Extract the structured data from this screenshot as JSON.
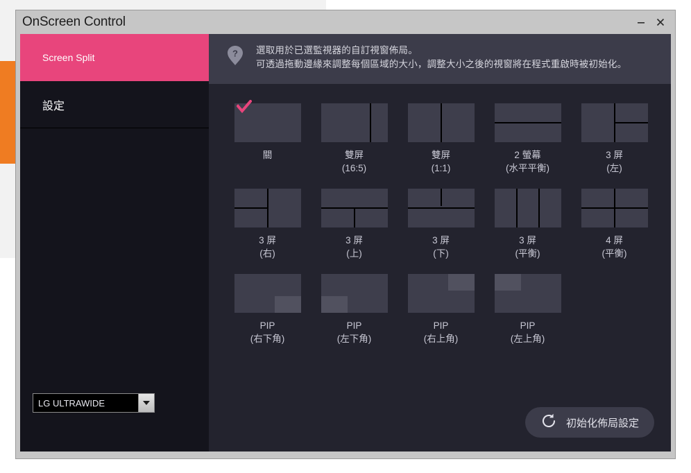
{
  "window": {
    "title": "OnScreen Control",
    "minimize_label": "–",
    "close_label": "×"
  },
  "sidebar": {
    "items": [
      {
        "label": "Screen Split",
        "active": true
      },
      {
        "label": "設定",
        "active": false
      }
    ],
    "monitor_select": {
      "value": "LG ULTRAWIDE"
    }
  },
  "info": {
    "text": "選取用於已選監視器的自訂視窗佈局。\n可透過拖動邊緣來調整每個區域的大小，調整大小之後的視窗將在程式重啟時被初始化。",
    "icon": "help-icon"
  },
  "layouts": [
    {
      "caption": "關",
      "selected": true
    },
    {
      "caption": "雙屏\n(16:5)",
      "selected": false
    },
    {
      "caption": "雙屏\n(1:1)",
      "selected": false
    },
    {
      "caption": "2 螢幕\n(水平平衡)",
      "selected": false
    },
    {
      "caption": "3 屏\n(左)",
      "selected": false
    },
    {
      "caption": "3 屏\n(右)",
      "selected": false
    },
    {
      "caption": "3 屏\n(上)",
      "selected": false
    },
    {
      "caption": "3 屏\n(下)",
      "selected": false
    },
    {
      "caption": "3 屏\n(平衡)",
      "selected": false
    },
    {
      "caption": "4 屏\n(平衡)",
      "selected": false
    },
    {
      "caption": "PIP\n(右下角)",
      "selected": false
    },
    {
      "caption": "PIP\n(左下角)",
      "selected": false
    },
    {
      "caption": "PIP\n(右上角)",
      "selected": false
    },
    {
      "caption": "PIP\n(左上角)",
      "selected": false
    }
  ],
  "reset": {
    "label": "初始化佈局設定",
    "icon": "refresh-icon"
  },
  "colors": {
    "accent_pink": "#e8457c",
    "sidebar_bg": "#14141c",
    "main_bg": "#23232e",
    "tile_bg": "#3e3e4c",
    "banner_bg": "#3c3c4a",
    "desktop_orange": "#ef7c22"
  }
}
